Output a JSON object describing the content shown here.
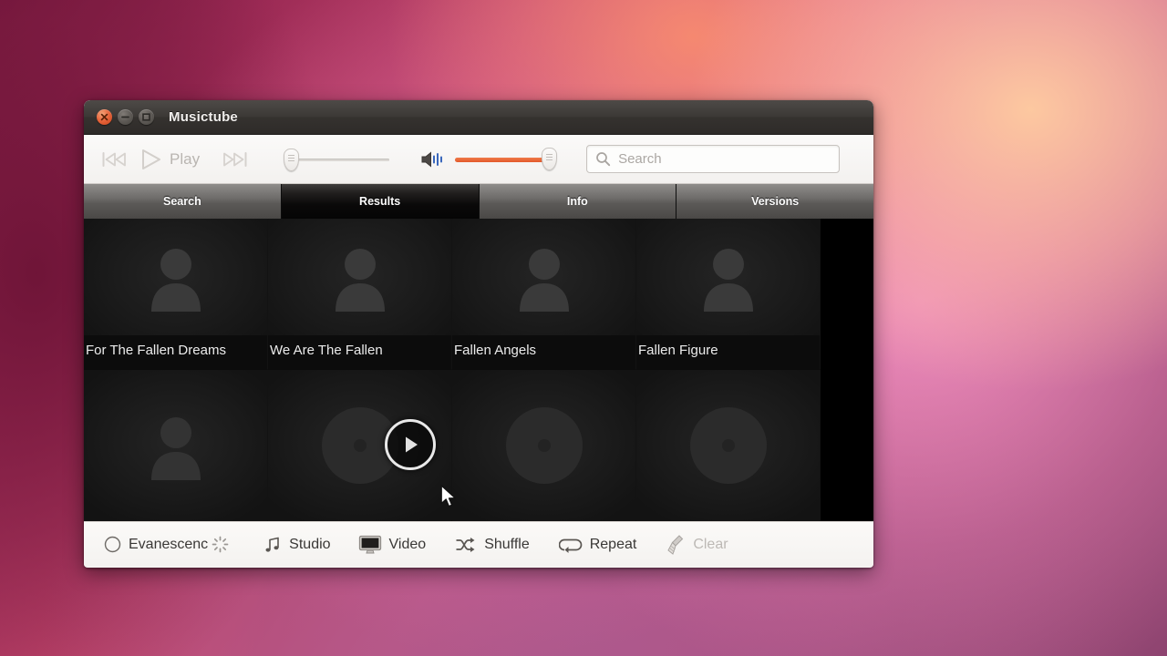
{
  "window": {
    "title": "Musictube",
    "controls": {
      "close": "close-button",
      "minimize": "minimize-button",
      "maximize": "maximize-button"
    }
  },
  "toolbar": {
    "previous_label": "Previous",
    "play_label": "Play",
    "next_label": "Next",
    "progress_value": 0,
    "volume_value": 100,
    "volume_color": "#e2592a"
  },
  "search": {
    "placeholder": "Search",
    "value": "",
    "icon": "search-icon"
  },
  "tabs": [
    {
      "label": "Search",
      "active": false
    },
    {
      "label": "Results",
      "active": true
    },
    {
      "label": "Info",
      "active": false
    },
    {
      "label": "Versions",
      "active": false
    }
  ],
  "results": {
    "row1": [
      {
        "title": "For The Fallen Dreams",
        "thumb": "person-placeholder-icon"
      },
      {
        "title": "We Are The Fallen",
        "thumb": "person-placeholder-icon"
      },
      {
        "title": "Fallen Angels",
        "thumb": "person-placeholder-icon"
      },
      {
        "title": "Fallen Figure",
        "thumb": "person-placeholder-icon"
      }
    ],
    "row2": [
      {
        "title": "",
        "thumb": "person-placeholder-icon"
      },
      {
        "title": "",
        "thumb": "disc-placeholder-icon"
      },
      {
        "title": "",
        "thumb": "disc-placeholder-icon"
      },
      {
        "title": "",
        "thumb": "disc-placeholder-icon"
      }
    ],
    "overlay_play": "play-overlay-icon"
  },
  "bottombar": {
    "now_playing": "Evanescenc",
    "now_playing_icon": "circle-icon",
    "spinner_icon": "loading-spinner-icon",
    "items": [
      {
        "label": "Studio",
        "icon": "music-note-icon",
        "disabled": false
      },
      {
        "label": "Video",
        "icon": "monitor-icon",
        "disabled": false
      },
      {
        "label": "Shuffle",
        "icon": "shuffle-icon",
        "disabled": false
      },
      {
        "label": "Repeat",
        "icon": "repeat-icon",
        "disabled": false
      },
      {
        "label": "Clear",
        "icon": "broom-icon",
        "disabled": true
      }
    ]
  }
}
